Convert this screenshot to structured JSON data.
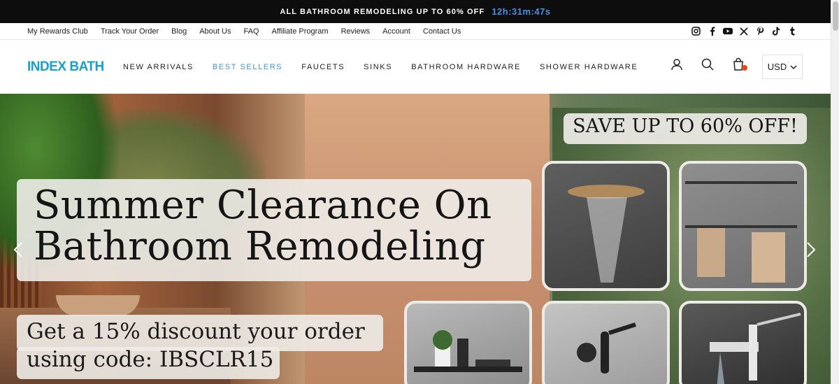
{
  "announcement": {
    "text": "ALL BATHROOM REMODELING UP TO 60% OFF",
    "timer": "12h:31m:47s"
  },
  "utility_nav": {
    "links": [
      "My Rewards Club",
      "Track Your Order",
      "Blog",
      "About Us",
      "FAQ",
      "Affiliate Program",
      "Reviews",
      "Account",
      "Contact Us"
    ],
    "socials": [
      "instagram-icon",
      "facebook-icon",
      "youtube-icon",
      "x-icon",
      "pinterest-icon",
      "tiktok-icon",
      "tumblr-icon"
    ]
  },
  "header": {
    "logo": "INDEX BATH",
    "nav": [
      "NEW ARRIVALS",
      "BEST SELLERS",
      "FAUCETS",
      "SINKS",
      "BATHROOM HARDWARE",
      "SHOWER HARDWARE"
    ],
    "active_nav": "BEST SELLERS",
    "currency": "USD"
  },
  "hero": {
    "headline_line1": "Summer Clearance On",
    "headline_line2": "Bathroom Remodeling",
    "sub_line1": "Get a 15% discount your order",
    "sub_line2": "using code: IBSCLR15",
    "badge": "SAVE UP TO 60% OFF!"
  },
  "colors": {
    "accent": "#1a9fc9",
    "active_nav": "#3d9ad6",
    "timer": "#4a90e2",
    "cart_dot": "#e8471e"
  }
}
